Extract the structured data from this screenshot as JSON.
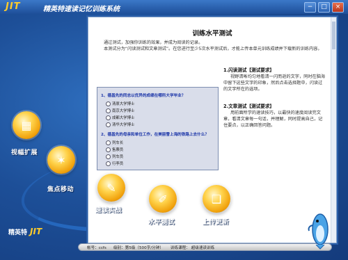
{
  "app": {
    "logo": "JIT",
    "title": "精英特速读记忆训练系统",
    "window_buttons": [
      "−",
      "□",
      "×"
    ]
  },
  "panel": {
    "title": "训练水平测试",
    "intro": [
      "通过测试，加强你训练的效果，并成为阅读的记录。",
      "本测试分为“闪读测试和文章测试”。在您进行至少5次水平测试后，才能上传本单元训练成绩并下载新的训练内容。"
    ],
    "quiz": {
      "q1": "1、德昌先的同志以优异的成绩在哪所大学毕业？",
      "q1_options": [
        "清原大学博士",
        "南京大学博士",
        "成都大学博士",
        "清华大学博士"
      ],
      "q2": "2、德昌先的母亲和单位工作，在美丽雪上海的铁路上去什么？",
      "q2_options": [
        "列车长",
        "售票员",
        "列车员",
        "行李员"
      ]
    },
    "side": {
      "h1": "1.闪读测试【测试要求】",
      "p1": "视野清晰均匀地看清一闪而逝的文字，同时在脑海中留下这些文字的印象，然后点击选择题中，闪读过的文字所在的选项。",
      "h2": "2.文章测试【测试要求】",
      "p2": "用前面所学的速读技巧，以最快的速度阅读完文章，看清文章每一句话，并理解，同时提高自己，记住要点，以正确回答问题。"
    }
  },
  "nav": [
    {
      "label": "视幅扩展",
      "icon": "film-frame-icon"
    },
    {
      "label": "焦点移动",
      "icon": "focus-arrows-icon"
    },
    {
      "label": "速读实战",
      "icon": "open-book-icon"
    },
    {
      "label": "水平测试",
      "icon": "test-pen-icon"
    },
    {
      "label": "上传更新",
      "icon": "upload-book-icon"
    }
  ],
  "bottom_logo": {
    "cn": "精英特",
    "en": "JIT"
  },
  "status": {
    "account": "帐号：ccfs",
    "level": "级别：第5级（500字/分钟）",
    "course": "训练课程： 超级速读训练"
  }
}
